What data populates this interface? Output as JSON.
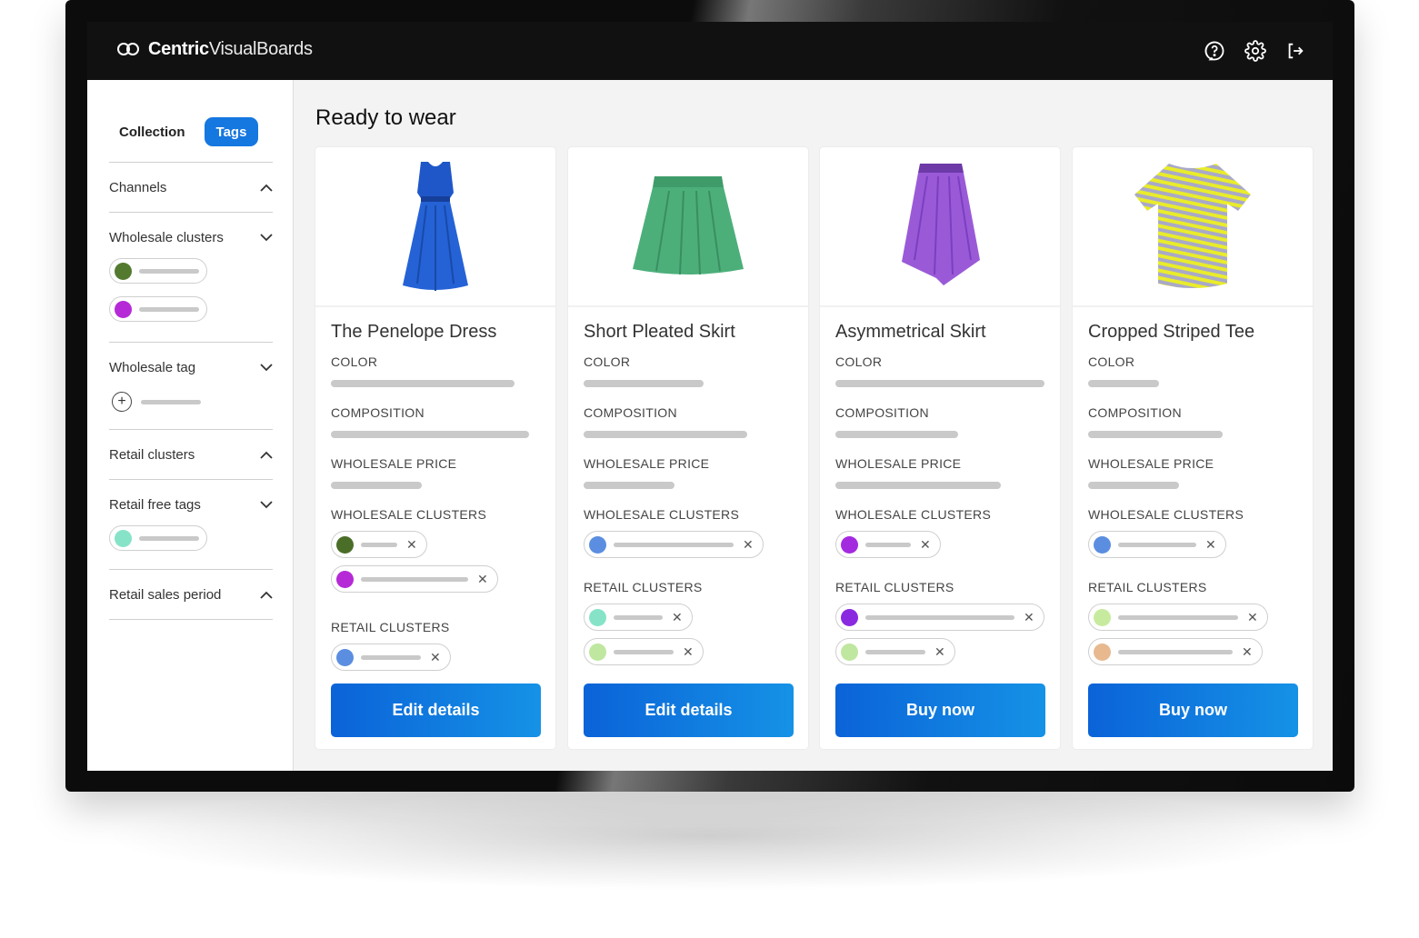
{
  "app": {
    "brand_bold": "Centric",
    "brand_light": "VisualBoards"
  },
  "topbar": {
    "icons": [
      "help-icon",
      "settings-gear-icon",
      "logout-icon"
    ]
  },
  "sidebar": {
    "tabs": [
      {
        "label": "Collection",
        "active": false
      },
      {
        "label": "Tags",
        "active": true
      }
    ],
    "sections": [
      {
        "title": "Channels",
        "expanded": true
      },
      {
        "title": "Wholesale clusters",
        "expanded": false,
        "swatches": [
          "#537a2e",
          "#b52ad6"
        ]
      },
      {
        "title": "Wholesale tag",
        "expanded": false
      },
      {
        "title": "Retail clusters",
        "expanded": true
      },
      {
        "title": "Retail free tags",
        "expanded": false,
        "swatches": [
          "#86e3c8"
        ]
      },
      {
        "title": "Retail sales period",
        "expanded": true
      }
    ]
  },
  "main": {
    "title": "Ready to wear",
    "field_labels": {
      "color": "COLOR",
      "composition": "COMPOSITION",
      "wholesale_price": "WHOLESALE PRICE",
      "wholesale_clusters": "WHOLESALE CLUSTERS",
      "retail_clusters": "RETAIL CLUSTERS"
    },
    "products": [
      {
        "name": "The Penelope Dress",
        "image": "blue-dress",
        "button": "Edit details",
        "wholesale_clusters": [
          "#4a6e28",
          "#b52ad6"
        ],
        "retail_clusters": [
          "#5b8ee0"
        ]
      },
      {
        "name": "Short Pleated Skirt",
        "image": "green-skirt",
        "button": "Edit details",
        "wholesale_clusters": [
          "#5b8ee0"
        ],
        "retail_clusters": [
          "#86e3c8",
          "#bfe7a0"
        ]
      },
      {
        "name": "Asymmetrical Skirt",
        "image": "purple-skirt",
        "button": "Buy now",
        "wholesale_clusters": [
          "#a42ae0"
        ],
        "retail_clusters": [
          "#8a2ae0",
          "#bfe7a0"
        ]
      },
      {
        "name": "Cropped Striped Tee",
        "image": "striped-tee",
        "button": "Buy now",
        "wholesale_clusters": [
          "#5b8ee0"
        ],
        "retail_clusters": [
          "#c7eb9e",
          "#e8b98f"
        ]
      }
    ]
  }
}
